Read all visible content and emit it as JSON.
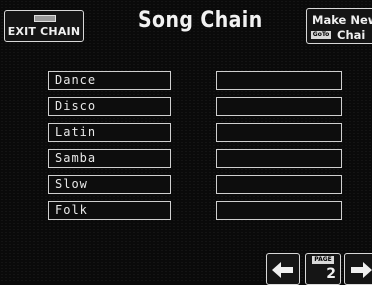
{
  "header": {
    "exit_label": "EXIT CHAIN",
    "title": "Song Chain",
    "make_new_line1": "Make New",
    "make_new_line2": "Chai",
    "goto_badge": "GoTo"
  },
  "slots_left": [
    "Dance",
    "Disco",
    "Latin",
    "Samba",
    "Slow",
    "Folk"
  ],
  "slots_right": [
    "",
    "",
    "",
    "",
    "",
    ""
  ],
  "pager": {
    "page_label": "PAGE",
    "page_number": "2",
    "prev_icon": "arrow-left-icon",
    "next_icon": "arrow-right-icon"
  }
}
